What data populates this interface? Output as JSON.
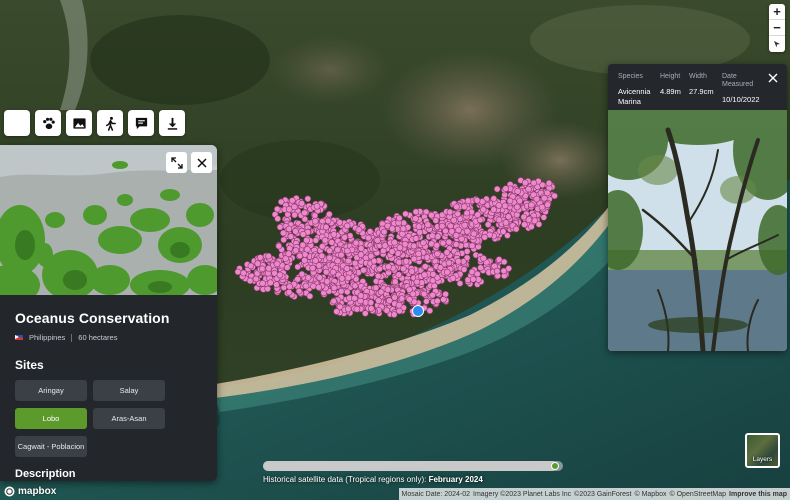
{
  "toolbar": {
    "buttons": [
      {
        "name": "trees-tab",
        "icon": "trees-icon",
        "active": true
      },
      {
        "name": "wildlife-tab",
        "icon": "paw-icon",
        "active": false
      },
      {
        "name": "media-tab",
        "icon": "image-icon",
        "active": false
      },
      {
        "name": "people-tab",
        "icon": "person-icon",
        "active": false
      },
      {
        "name": "feedback-tab",
        "icon": "chat-icon",
        "active": false
      },
      {
        "name": "download-tab",
        "icon": "download-icon",
        "active": false
      }
    ]
  },
  "site": {
    "title": "Oceanus Conservation",
    "country": "Philippines",
    "area": "60 hectares",
    "sites_heading": "Sites",
    "sites": [
      {
        "label": "Aringay",
        "active": false
      },
      {
        "label": "Salay",
        "active": false
      },
      {
        "label": "Lobo",
        "active": true
      },
      {
        "label": "Aras-Asan",
        "active": false
      },
      {
        "label": "Cagwait - Poblacion",
        "active": false
      }
    ],
    "description_heading": "Description"
  },
  "tree": {
    "species_label": "Species",
    "height_label": "Height",
    "width_label": "Width",
    "date_label_1": "Date",
    "date_label_2": "Measured",
    "species_value_1": "Avicennia",
    "species_value_2": "Marina",
    "height_value": "4.89m",
    "width_value": "27.9cm",
    "date_value": "10/10/2022"
  },
  "zoom": {
    "in_label": "+",
    "out_label": "−"
  },
  "layers": {
    "label": "Layers"
  },
  "timeline": {
    "prefix": "Historical satellite data (Tropical regions only):",
    "date": "February 2024",
    "progress": 0.98
  },
  "attribution": {
    "mosaic": "Mosaic Date: 2024-02",
    "imagery": "Imagery ©2023 Planet Labs Inc",
    "gainforest": "©2023 GainForest",
    "mapbox": "© Mapbox",
    "osm": "© OpenStreetMap",
    "improve": "Improve this map",
    "logo": "mapbox"
  },
  "colors": {
    "accent": "#5d9a2c",
    "point": "#ee88cc",
    "point_selected": "#2d8cf0",
    "panel": "#23262b"
  }
}
